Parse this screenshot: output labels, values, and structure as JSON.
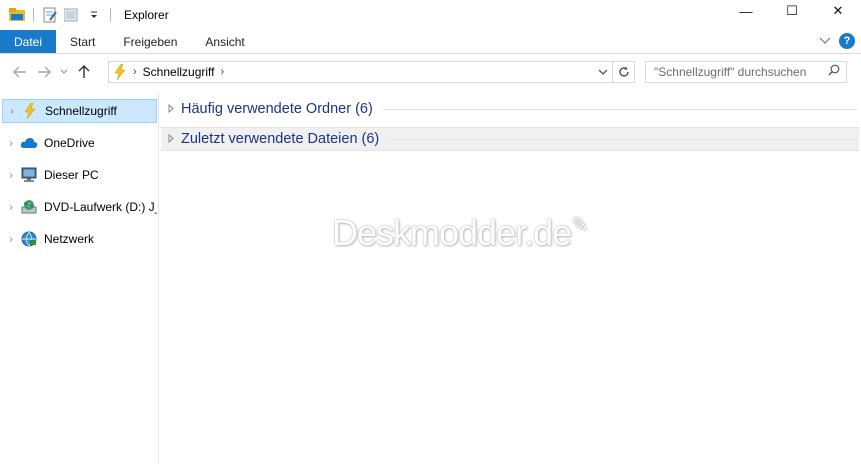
{
  "window": {
    "title": "Explorer",
    "controls": {
      "minimize": "—",
      "maximize": "☐",
      "close": "✕"
    }
  },
  "ribbon": {
    "tabs": [
      {
        "label": "Datei",
        "active": true
      },
      {
        "label": "Start"
      },
      {
        "label": "Freigeben"
      },
      {
        "label": "Ansicht"
      }
    ],
    "help_label": "?"
  },
  "address": {
    "breadcrumb": "Schnellzugriff",
    "search_placeholder": "\"Schnellzugriff\" durchsuchen"
  },
  "nav": {
    "items": [
      {
        "label": "Schnellzugriff",
        "icon": "quick-access-icon",
        "selected": true
      },
      {
        "label": "OneDrive",
        "icon": "onedrive-icon"
      },
      {
        "label": "Dieser PC",
        "icon": "this-pc-icon"
      },
      {
        "label": "DVD-Laufwerk (D:) J_",
        "icon": "dvd-drive-icon"
      },
      {
        "label": "Netzwerk",
        "icon": "network-icon"
      }
    ]
  },
  "content": {
    "groups": [
      {
        "label": "Häufig verwendete Ordner (6)"
      },
      {
        "label": "Zuletzt verwendete Dateien (6)"
      }
    ],
    "watermark": "Deskmodder.de"
  },
  "colors": {
    "accent": "#1979ca",
    "group_text": "#1e3287",
    "selection_bg": "#cce8ff",
    "selection_border": "#99d1ff"
  }
}
